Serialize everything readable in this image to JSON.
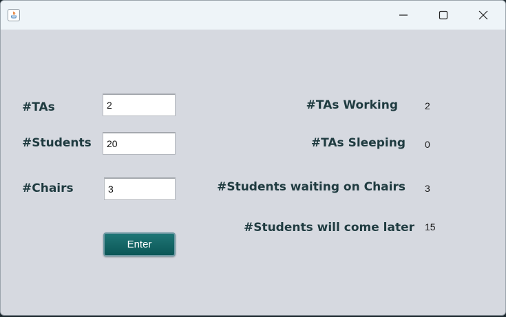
{
  "window": {
    "title": "",
    "controls": [
      "minimize-icon",
      "maximize-icon",
      "close-icon"
    ]
  },
  "inputs": {
    "tas_label": "#TAs",
    "tas_value": "2",
    "students_label": "#Students",
    "students_value": "20",
    "chairs_label": "#Chairs",
    "chairs_value": "3",
    "enter_label": "Enter"
  },
  "status": {
    "tas_working_label": "#TAs Working",
    "tas_working_value": "2",
    "tas_sleeping_label": "#TAs Sleeping",
    "tas_sleeping_value": "0",
    "students_waiting_label": "#Students waiting on Chairs",
    "students_waiting_value": "3",
    "students_later_label": "#Students will come later",
    "students_later_value": "15"
  },
  "colors": {
    "window_bg": "#d6d9e0",
    "titlebar_bg": "#eef4f8",
    "label_text": "#1f3b40",
    "button_bg": "#0b5656"
  }
}
